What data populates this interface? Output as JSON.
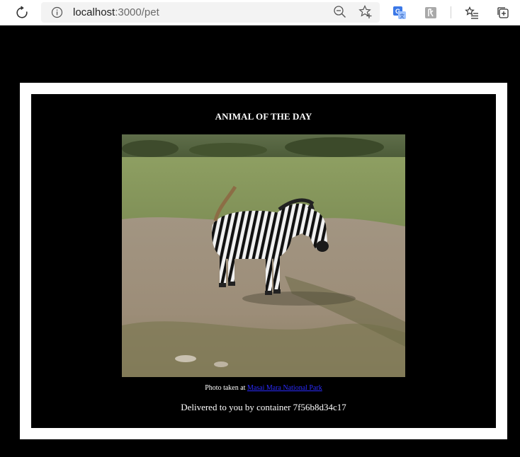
{
  "browser": {
    "url_host": "localhost",
    "url_path": ":3000/pet",
    "icons": [
      "reload-icon",
      "info-icon",
      "zoom-icon",
      "favorite-star-icon",
      "translate-icon",
      "extension-icon",
      "favorites-icon",
      "collections-icon"
    ]
  },
  "page": {
    "heading": "ANIMAL OF THE DAY",
    "image_subject": "zebra",
    "caption_prefix": "Photo taken at ",
    "caption_link": "Masai Mara National Park",
    "delivered_text": "Delivered to you by container 7f56b8d34c17"
  },
  "colors": {
    "page_background": "#000000",
    "frame": "#ffffff",
    "link": "#2b2bff"
  }
}
